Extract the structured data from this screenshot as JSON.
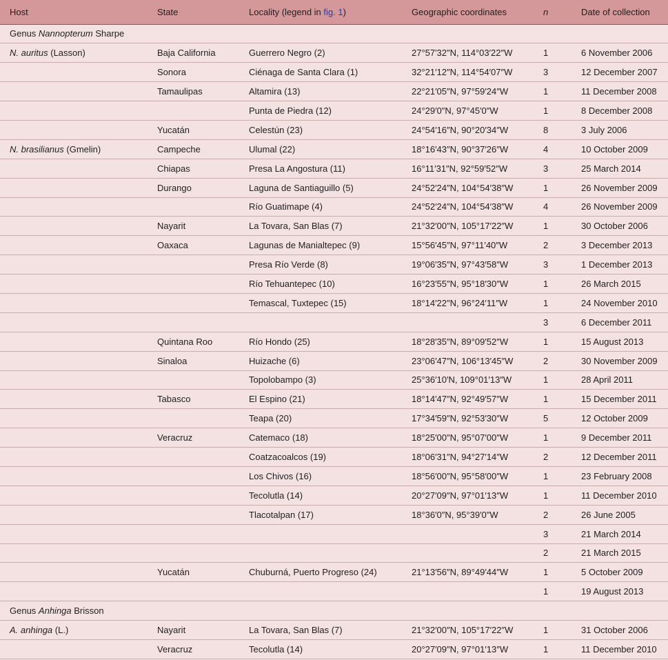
{
  "table": {
    "headers": {
      "host": "Host",
      "state": "State",
      "locality_prefix": "Locality (legend in ",
      "locality_link": "fig. 1",
      "locality_suffix": ")",
      "coords": "Geographic coordinates",
      "n": "n",
      "date": "Date of collection"
    },
    "sections": [
      {
        "genus_prefix": "Genus ",
        "genus_name": "Nannopterum",
        "genus_author": " Sharpe",
        "rows": [
          {
            "host_sp": "N. auritus",
            "host_auth": " (Lasson)",
            "state": "Baja California",
            "locality": "Guerrero Negro (2)",
            "coords": "27°57′32″N, 114°03′22″W",
            "n": "1",
            "date": "6 November 2006"
          },
          {
            "host_sp": "",
            "host_auth": "",
            "state": "Sonora",
            "locality": "Ciénaga de Santa Clara (1)",
            "coords": "32°21′12″N, 114°54′07″W",
            "n": "3",
            "date": "12 December 2007"
          },
          {
            "host_sp": "",
            "host_auth": "",
            "state": "Tamaulipas",
            "locality": "Altamira (13)",
            "coords": "22°21′05″N, 97°59′24″W",
            "n": "1",
            "date": "11 December 2008"
          },
          {
            "host_sp": "",
            "host_auth": "",
            "state": "",
            "locality": "Punta de Piedra (12)",
            "coords": "24°29′0″N, 97°45′0″W",
            "n": "1",
            "date": "8 December 2008"
          },
          {
            "host_sp": "",
            "host_auth": "",
            "state": "Yucatán",
            "locality": "Celestún (23)",
            "coords": "24°54′16″N, 90°20′34″W",
            "n": "8",
            "date": "3 July 2006"
          },
          {
            "host_sp": "N. brasilianus",
            "host_auth": " (Gmelin)",
            "state": "Campeche",
            "locality": "Ulumal (22)",
            "coords": "18°16′43″N, 90°37′26″W",
            "n": "4",
            "date": "10 October 2009"
          },
          {
            "host_sp": "",
            "host_auth": "",
            "state": "Chiapas",
            "locality": "Presa La Angostura (11)",
            "coords": "16°11′31″N, 92°59′52″W",
            "n": "3",
            "date": "25 March 2014"
          },
          {
            "host_sp": "",
            "host_auth": "",
            "state": "Durango",
            "locality": "Laguna de Santiaguillo (5)",
            "coords": "24°52′24″N, 104°54′38″W",
            "n": "1",
            "date": "26 November 2009"
          },
          {
            "host_sp": "",
            "host_auth": "",
            "state": "",
            "locality": "Río Guatimape (4)",
            "coords": "24°52′24″N, 104°54′38″W",
            "n": "4",
            "date": "26 November 2009"
          },
          {
            "host_sp": "",
            "host_auth": "",
            "state": "Nayarit",
            "locality": "La Tovara, San Blas (7)",
            "coords": "21°32′00″N, 105°17′22″W",
            "n": "1",
            "date": "30 October 2006"
          },
          {
            "host_sp": "",
            "host_auth": "",
            "state": "Oaxaca",
            "locality": "Lagunas de Manialtepec (9)",
            "coords": "15°56′45″N, 97°11′40″W",
            "n": "2",
            "date": "3 December 2013"
          },
          {
            "host_sp": "",
            "host_auth": "",
            "state": "",
            "locality": "Presa Río Verde (8)",
            "coords": "19°06′35″N, 97°43′58″W",
            "n": "3",
            "date": "1 December 2013"
          },
          {
            "host_sp": "",
            "host_auth": "",
            "state": "",
            "locality": "Río Tehuantepec (10)",
            "coords": "16°23′55″N, 95°18′30″W",
            "n": "1",
            "date": "26 March 2015"
          },
          {
            "host_sp": "",
            "host_auth": "",
            "state": "",
            "locality": "Temascal, Tuxtepec (15)",
            "coords": "18°14′22″N, 96°24′11″W",
            "n": "1",
            "date": "24 November 2010"
          },
          {
            "host_sp": "",
            "host_auth": "",
            "state": "",
            "locality": "",
            "coords": "",
            "n": "3",
            "date": "6 December 2011"
          },
          {
            "host_sp": "",
            "host_auth": "",
            "state": "Quintana Roo",
            "locality": "Río Hondo (25)",
            "coords": "18°28′35″N, 89°09′52″W",
            "n": "1",
            "date": "15 August 2013"
          },
          {
            "host_sp": "",
            "host_auth": "",
            "state": "Sinaloa",
            "locality": "Huizache (6)",
            "coords": "23°06′47″N, 106°13′45″W",
            "n": "2",
            "date": "30 November 2009"
          },
          {
            "host_sp": "",
            "host_auth": "",
            "state": "",
            "locality": "Topolobampo (3)",
            "coords": "25°36′10′N, 109°01′13″W",
            "n": "1",
            "date": "28 April 2011"
          },
          {
            "host_sp": "",
            "host_auth": "",
            "state": "Tabasco",
            "locality": "El Espino (21)",
            "coords": "18°14′47″N, 92°49′57″W",
            "n": "1",
            "date": "15 December 2011"
          },
          {
            "host_sp": "",
            "host_auth": "",
            "state": "",
            "locality": "Teapa (20)",
            "coords": "17°34′59″N, 92°53′30″W",
            "n": "5",
            "date": "12 October 2009"
          },
          {
            "host_sp": "",
            "host_auth": "",
            "state": "Veracruz",
            "locality": "Catemaco (18)",
            "coords": "18°25′00″N, 95°07′00″W",
            "n": "1",
            "date": "9 December 2011"
          },
          {
            "host_sp": "",
            "host_auth": "",
            "state": "",
            "locality": "Coatzacoalcos (19)",
            "coords": "18°06′31″N, 94°27′14″W",
            "n": "2",
            "date": "12 December 2011"
          },
          {
            "host_sp": "",
            "host_auth": "",
            "state": "",
            "locality": "Los Chivos (16)",
            "coords": "18°56′00″N, 95°58′00″W",
            "n": "1",
            "date": "23 February 2008"
          },
          {
            "host_sp": "",
            "host_auth": "",
            "state": "",
            "locality": "Tecolutla (14)",
            "coords": "20°27′09″N, 97°01′13″W",
            "n": "1",
            "date": "11 December 2010"
          },
          {
            "host_sp": "",
            "host_auth": "",
            "state": "",
            "locality": "Tlacotalpan (17)",
            "coords": "18°36′0″N, 95°39′0″W",
            "n": "2",
            "date": "26 June 2005"
          },
          {
            "host_sp": "",
            "host_auth": "",
            "state": "",
            "locality": "",
            "coords": "",
            "n": "3",
            "date": "21 March 2014"
          },
          {
            "host_sp": "",
            "host_auth": "",
            "state": "",
            "locality": "",
            "coords": "",
            "n": "2",
            "date": "21 March 2015"
          },
          {
            "host_sp": "",
            "host_auth": "",
            "state": "Yucatán",
            "locality": "Chuburná, Puerto Progreso (24)",
            "coords": "21°13′56″N, 89°49′44″W",
            "n": "1",
            "date": "5 October 2009"
          },
          {
            "host_sp": "",
            "host_auth": "",
            "state": "",
            "locality": "",
            "coords": "",
            "n": "1",
            "date": "19 August 2013"
          }
        ]
      },
      {
        "genus_prefix": "Genus ",
        "genus_name": "Anhinga",
        "genus_author": " Brisson",
        "rows": [
          {
            "host_sp": "A. anhinga",
            "host_auth": " (L.)",
            "state": "Nayarit",
            "locality": "La Tovara, San Blas (7)",
            "coords": "21°32′00″N, 105°17′22″W",
            "n": "1",
            "date": "31 October 2006"
          },
          {
            "host_sp": "",
            "host_auth": "",
            "state": "Veracruz",
            "locality": "Tecolutla (14)",
            "coords": "20°27′09″N, 97°01′13″W",
            "n": "1",
            "date": "11 December 2010"
          }
        ]
      }
    ]
  }
}
